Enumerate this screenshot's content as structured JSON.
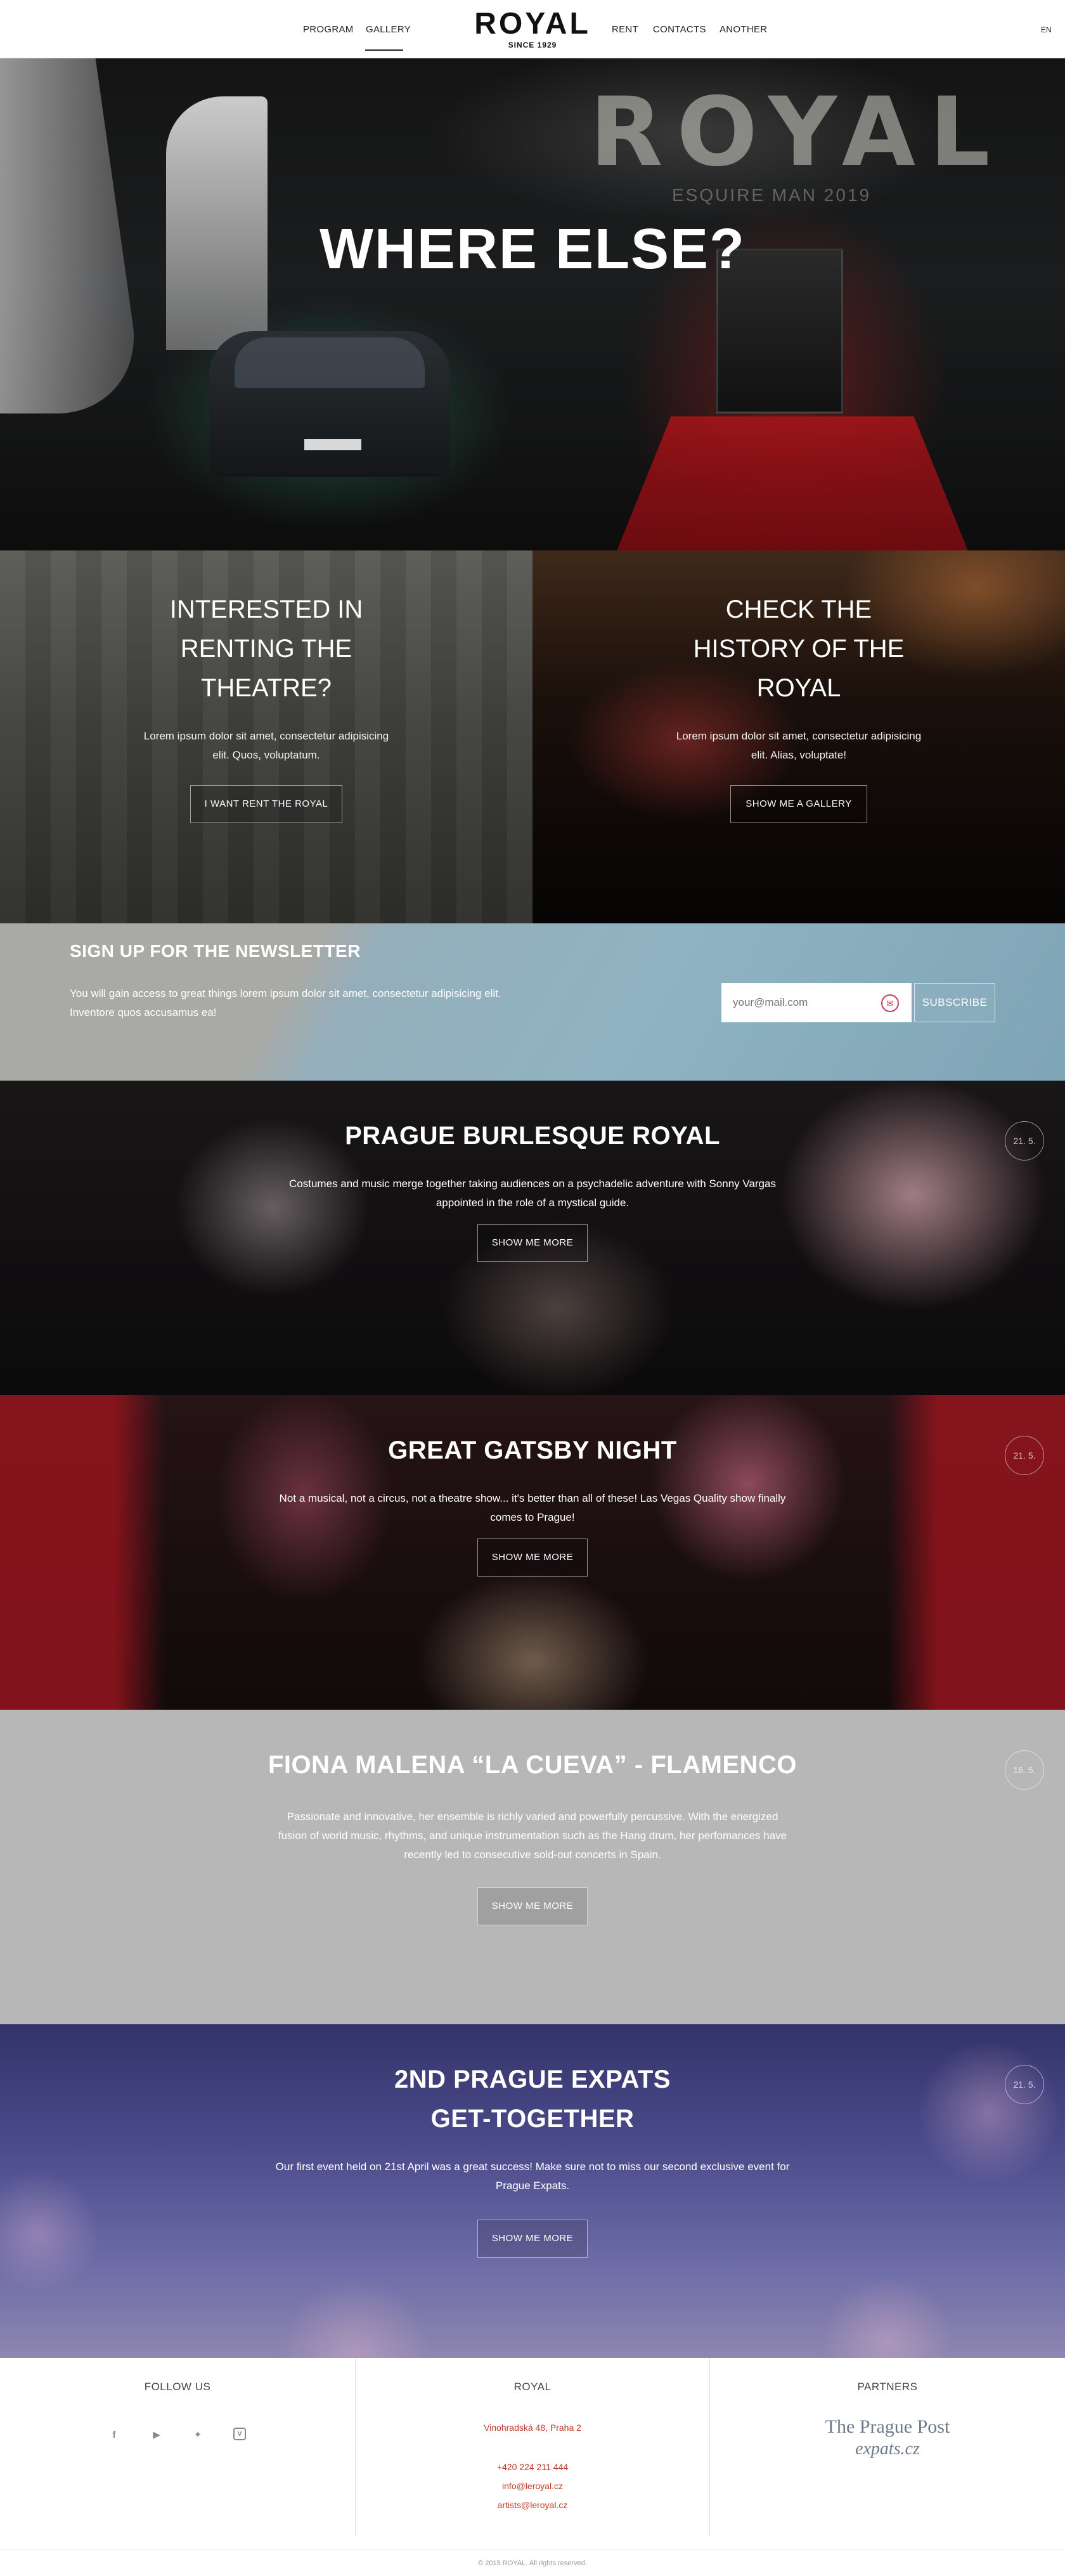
{
  "header": {
    "nav_left": [
      "PROGRAM",
      "GALLERY"
    ],
    "nav_right": [
      "RENT",
      "CONTACTS",
      "ANOTHER"
    ],
    "active_item": "GALLERY",
    "logo": "ROYAL",
    "logo_since": "SINCE 1929",
    "language": "EN"
  },
  "hero": {
    "title": "WHERE ELSE?",
    "sign_text": "ROYAL",
    "sign_sub": "ESQUIRE MAN 2019"
  },
  "promos": [
    {
      "title": "INTERESTED IN RENTING THE THEATRE?",
      "text": "Lorem ipsum dolor sit amet, consectetur adipisicing elit. Quos, voluptatum.",
      "button": "I WANT RENT THE ROYAL"
    },
    {
      "title": "CHECK THE HISTORY OF THE ROYAL",
      "text": "Lorem ipsum dolor sit amet, consectetur adipisicing elit. Alias, voluptate!",
      "button": "SHOW ME A GALLERY"
    }
  ],
  "newsletter": {
    "title": "SIGN UP FOR THE NEWSLETTER",
    "text": "You will gain access to great things lorem ipsum dolor sit amet, consectetur adipisicing elit. Inventore quos accusamus ea!",
    "placeholder": "your@mail.com",
    "button": "SUBSCRIBE"
  },
  "events": [
    {
      "title": "PRAGUE BURLESQUE ROYAL",
      "text": "Costumes and music merge together taking audiences on a psychadelic adventure with Sonny Vargas appointed in the role of a mystical guide.",
      "button": "SHOW ME MORE",
      "date": "21. 5."
    },
    {
      "title": "GREAT GATSBY NIGHT",
      "text": "Not a musical, not a circus, not a theatre show... it's better than all of these! Las Vegas Quality show finally comes to Prague!",
      "button": "SHOW ME MORE",
      "date": "21. 5."
    },
    {
      "title": "FIONA MALENA “LA CUEVA” - FLAMENCO",
      "text": "Passionate and innovative, her ensemble is richly varied and powerfully percussive. With the energized fusion of world music, rhythms, and unique instrumentation such as the Hang drum, her perfomances have recently led to consecutive sold-out concerts in Spain.",
      "button": "SHOW ME MORE",
      "date": "16. 5."
    },
    {
      "title": "2ND PRAGUE EXPATS GET-TOGETHER",
      "text": "Our first event held on 21st April was a great success! Make sure not to miss our second exclusive event for Prague Expats.",
      "button": "SHOW ME MORE",
      "date": "21. 5."
    }
  ],
  "footer": {
    "follow_title": "FOLLOW US",
    "social_icons": [
      "facebook-icon",
      "youtube-icon",
      "twitter-icon",
      "vine-icon"
    ],
    "royal_title": "ROYAL",
    "address": "Vinohradská 48, Praha 2",
    "phone": "+420 224 211 444",
    "email_info": "info@leroyal.cz",
    "email_artists": "artists@leroyal.cz",
    "partners_title": "PARTNERS",
    "partners": [
      "The Prague Post",
      "expats.cz"
    ],
    "copyright": "© 2015 ROYAL. All rights reserved."
  },
  "colors": {
    "link_red": "#c0392b",
    "newsletter_icon": "#c23b5b",
    "flamenco_bg": "#b7b7b7"
  }
}
